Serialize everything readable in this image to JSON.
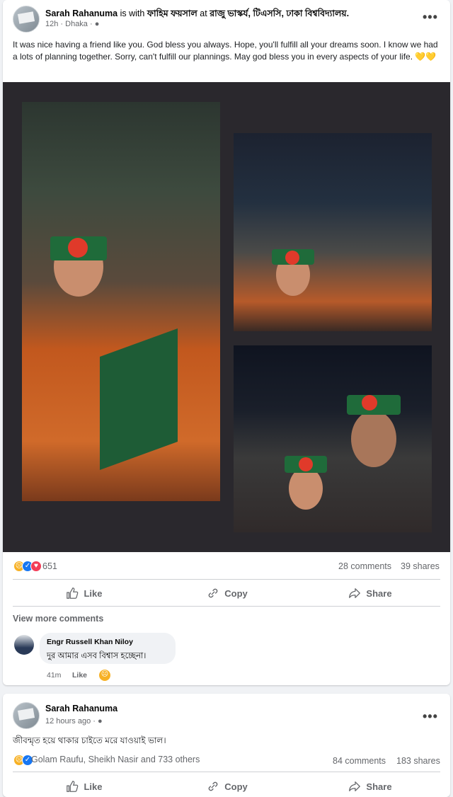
{
  "post1": {
    "author": "Sarah Rahanuma",
    "with_text": " is with ",
    "tagged_person": "ফাহিম ফয়সাল",
    "at_text": " at ",
    "location": "রাজু ভাস্কর্য, টিএসসি, ঢাকা বিশ্ববিদ্যালয়.",
    "time": "12h · Dhaka · ",
    "more": "•••",
    "text": "It was nice having a friend like you. God bless you always. Hope, you'll fulfill all your dreams soon. I know we had a lots of planning together. Sorry, can't fulfill our plannings. May god bless you in every aspects of your life. 💛💛",
    "reactions_count": "651",
    "comments_count": "28 comments",
    "shares_count": "39 shares",
    "actions": {
      "like": "Like",
      "copy": "Copy",
      "share": "Share"
    },
    "view_more_comments": "View more comments",
    "comment": {
      "author": "Engr Russell Khan Niloy",
      "text": "দুর আমার এসব বিশ্বাস হচ্ছেনা।",
      "time": "41m",
      "like": "Like"
    }
  },
  "post2": {
    "author": "Sarah Rahanuma",
    "time": "12 hours ago · ",
    "more": "•••",
    "text": "জীবন্মৃত হয়ে থাকার চাইতে মরে যাওয়াই ভাল।",
    "reactors": "Golam Raufu, Sheikh Nasir and 733 others",
    "comments_count": "84 comments",
    "shares_count": "183 shares",
    "actions": {
      "like": "Like",
      "copy": "Copy",
      "share": "Share"
    }
  },
  "colors": {
    "like_blue": "#1877f2",
    "love_red": "#f33e58",
    "sad_yellow": "#f7b125",
    "photo_bg": "#2a282d"
  }
}
